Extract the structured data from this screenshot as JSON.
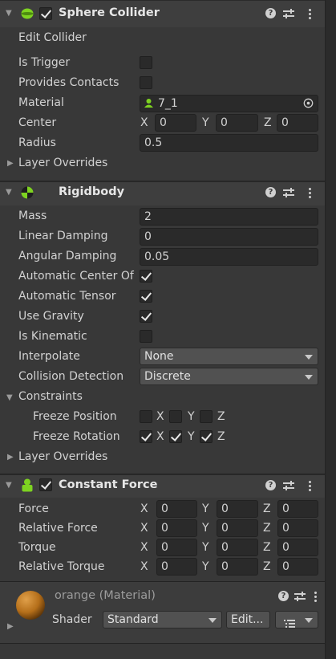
{
  "sphere_collider": {
    "title": "Sphere Collider",
    "edit_collider": "Edit Collider",
    "rows": {
      "is_trigger": "Is Trigger",
      "provides_contacts": "Provides Contacts",
      "material": "Material",
      "center": "Center",
      "radius": "Radius",
      "layer_overrides": "Layer Overrides"
    },
    "material_value": "7_1",
    "center": {
      "x": "0",
      "y": "0",
      "z": "0"
    },
    "radius_value": "0.5"
  },
  "rigidbody": {
    "title": "Rigidbody",
    "rows": {
      "mass": "Mass",
      "linear_damping": "Linear Damping",
      "angular_damping": "Angular Damping",
      "auto_center": "Automatic Center Of",
      "auto_tensor": "Automatic Tensor",
      "use_gravity": "Use Gravity",
      "is_kinematic": "Is Kinematic",
      "interpolate": "Interpolate",
      "collision_detection": "Collision Detection",
      "constraints": "Constraints",
      "freeze_position": "Freeze Position",
      "freeze_rotation": "Freeze Rotation",
      "layer_overrides": "Layer Overrides"
    },
    "mass_value": "2",
    "linear_damping_value": "0",
    "angular_damping_value": "0.05",
    "interpolate_value": "None",
    "collision_detection_value": "Discrete"
  },
  "constant_force": {
    "title": "Constant Force",
    "rows": {
      "force": "Force",
      "relative_force": "Relative Force",
      "torque": "Torque",
      "relative_torque": "Relative Torque"
    },
    "value": "0"
  },
  "axes": {
    "x": "X",
    "y": "Y",
    "z": "Z"
  },
  "material_panel": {
    "title": "orange (Material)",
    "shader_label": "Shader",
    "shader_value": "Standard",
    "edit_label": "Edit..."
  },
  "icons": {
    "help": "?",
    "kebab": "more-icon",
    "presets": "presets-icon"
  },
  "colors": {
    "background": "#383838",
    "header": "#3e3e3e",
    "field": "#2a2a2a",
    "accent_green": "#7ed321",
    "orange_material": "#c77a1c"
  }
}
